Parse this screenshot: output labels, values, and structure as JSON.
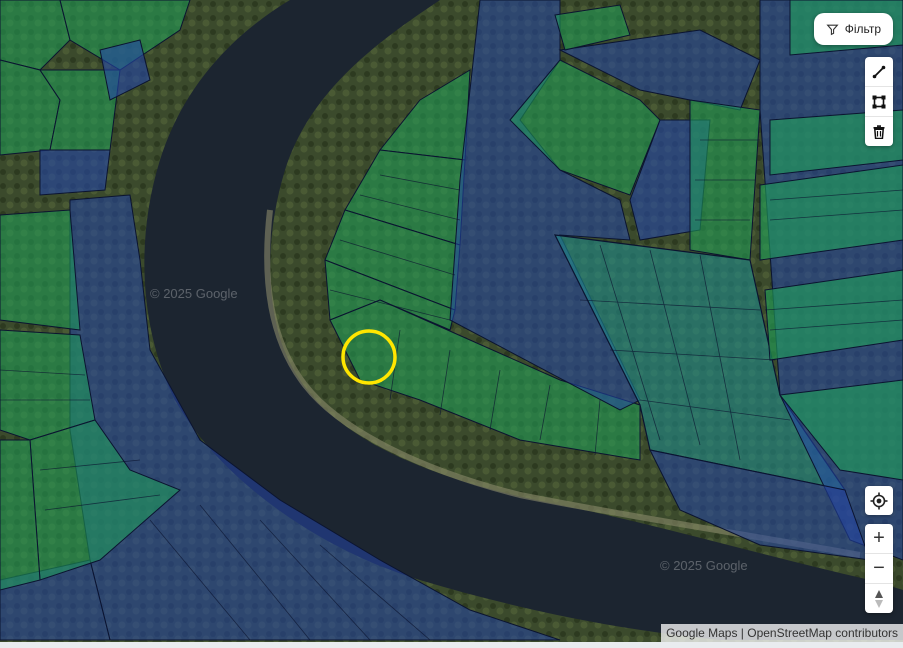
{
  "toolbar": {
    "filter_label": "Фільтр",
    "draw_tools": [
      "line-icon",
      "polygon-icon",
      "trash-icon"
    ]
  },
  "map_controls": {
    "locate_icon": "locate-icon",
    "zoom_in_label": "+",
    "zoom_out_label": "−",
    "compass_icon": "compass-icon"
  },
  "map": {
    "watermarks": [
      "© 2025 Google",
      "© 2025 Google"
    ],
    "attribution": "Google Maps | OpenStreetMap contributors",
    "highlight_color": "#ffe600",
    "parcel_colors": {
      "green": "#1fa35a",
      "blue": "#2546a8",
      "teal": "#1f8a8a"
    },
    "river_color": "#1c2530"
  }
}
